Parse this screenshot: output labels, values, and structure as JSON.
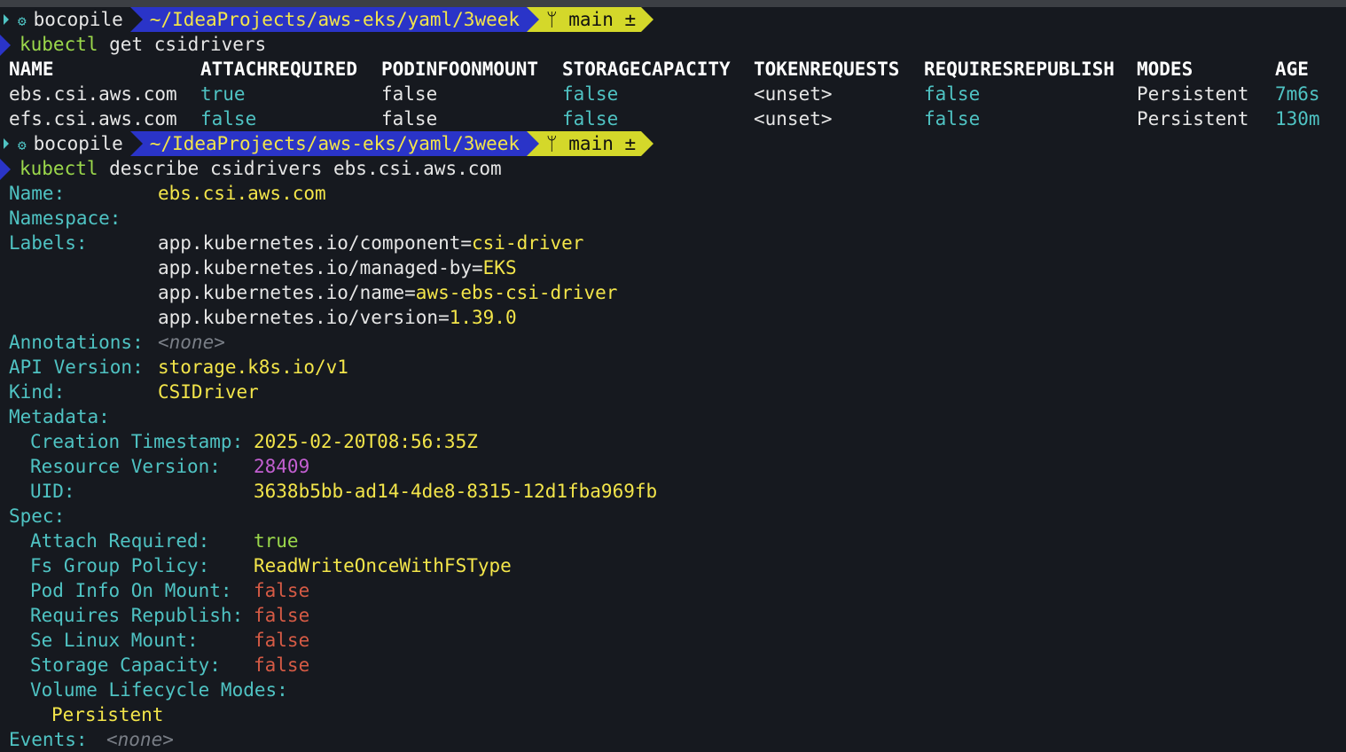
{
  "prompt": {
    "user": "bocopile",
    "path": "~/IdeaProjects/aws-eks/yaml/3week",
    "branch_icon": "git-branch-icon",
    "branch": "main ±"
  },
  "cmd1": {
    "tool": "kubectl",
    "args": " get csidrivers"
  },
  "table": {
    "headers": [
      "NAME",
      "ATTACHREQUIRED",
      "PODINFOONMOUNT",
      "STORAGECAPACITY",
      "TOKENREQUESTS",
      "REQUIRESREPUBLISH",
      "MODES",
      "AGE"
    ],
    "rows": [
      [
        "ebs.csi.aws.com",
        "true",
        "false",
        "false",
        "<unset>",
        "false",
        "Persistent",
        "7m6s"
      ],
      [
        "efs.csi.aws.com",
        "false",
        "false",
        "false",
        "<unset>",
        "false",
        "Persistent",
        "130m"
      ]
    ]
  },
  "cmd2": {
    "tool": "kubectl",
    "args": " describe csidrivers ebs.csi.aws.com"
  },
  "describe": {
    "name_label": "Name:",
    "name_value": "ebs.csi.aws.com",
    "namespace_label": "Namespace:",
    "labels_label": "Labels:",
    "labels": [
      {
        "key": "app.kubernetes.io/component=",
        "value": "csi-driver"
      },
      {
        "key": "app.kubernetes.io/managed-by=",
        "value": "EKS"
      },
      {
        "key": "app.kubernetes.io/name=",
        "value": "aws-ebs-csi-driver"
      },
      {
        "key": "app.kubernetes.io/version=",
        "value": "1.39.0"
      }
    ],
    "annotations_label": "Annotations:",
    "annotations_value": "<none>",
    "api_version_label": "API Version:",
    "api_version_value": "storage.k8s.io/v1",
    "kind_label": "Kind:",
    "kind_value": "CSIDriver",
    "metadata_label": "Metadata:",
    "creation_label": "Creation Timestamp:",
    "creation_value": "2025-02-20T08:56:35Z",
    "resource_version_label": "Resource Version:",
    "resource_version_value": "28409",
    "uid_label": "UID:",
    "uid_value": "3638b5bb-ad14-4de8-8315-12d1fba969fb",
    "spec_label": "Spec:",
    "attach_label": "Attach Required:",
    "attach_value": "true",
    "fsgroup_label": "Fs Group Policy:",
    "fsgroup_value": "ReadWriteOnceWithFSType",
    "podinfo_label": "Pod Info On Mount:",
    "podinfo_value": "false",
    "republish_label": "Requires Republish:",
    "republish_value": "false",
    "selinux_label": "Se Linux Mount:",
    "selinux_value": "false",
    "storage_label": "Storage Capacity:",
    "storage_value": "false",
    "lifecycle_label": "Volume Lifecycle Modes:",
    "lifecycle_value": "Persistent",
    "events_label": "Events:",
    "events_value": "<none>"
  }
}
